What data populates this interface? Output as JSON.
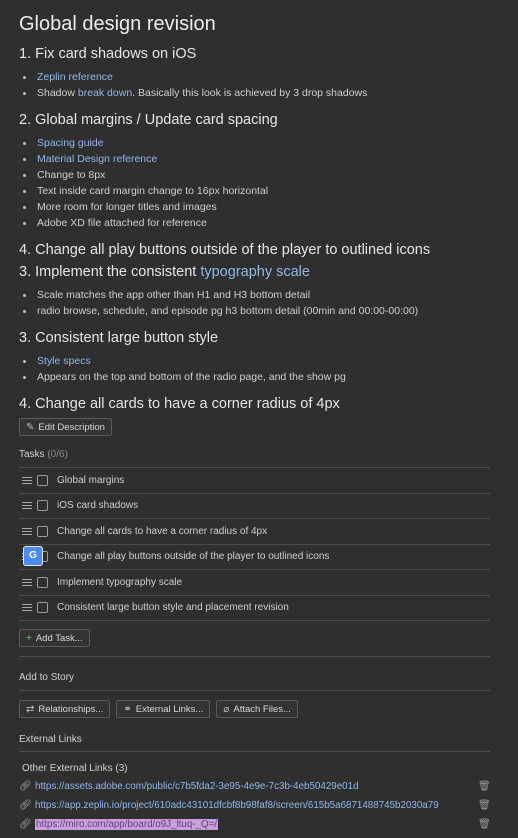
{
  "title": "Global design revision",
  "sections": {
    "s1": {
      "heading": "1. Fix card shadows on iOS",
      "items": [
        {
          "link": "Zeplin reference"
        }
      ],
      "shadow": {
        "pre": "Shadow ",
        "link": "break down",
        "post": ". Basically this look is achieved by 3 drop shadows"
      }
    },
    "s2": {
      "heading": "2. Global margins / Update card spacing",
      "links": [
        "Spacing guide",
        "Material Design reference"
      ],
      "items": [
        "Change to 8px",
        "Text inside card margin change to 16px horizontal",
        "More room for longer titles and images",
        "Adobe XD file attached for reference"
      ]
    },
    "s3": {
      "heading": "4. Change all play buttons outside of the player to outlined icons"
    },
    "s4": {
      "heading_pre": "3. Implement the consistent ",
      "heading_link": "typography scale",
      "items": [
        "Scale matches the app other than H1 and H3 bottom detail",
        "radio browse, schedule, and episode pg h3 bottom detail (00min and 00:00-00:00)"
      ]
    },
    "s5": {
      "heading": "3. Consistent large button style",
      "link": "Style specs",
      "items": [
        "Appears on the top and bottom of the radio page, and the show pg"
      ]
    },
    "s6": {
      "heading": "4. Change all cards to have a corner radius of 4px"
    }
  },
  "edit_description": "Edit Description",
  "tasks": {
    "label": "Tasks",
    "count": "(0/6)",
    "items": [
      "Global margins",
      "iOS card shadows",
      "Change all cards to have a corner radius of 4px",
      "Change all play buttons outside of the player to outlined icons",
      "Implement typography scale",
      "Consistent large button style and placement revision"
    ],
    "add_label": "Add Task..."
  },
  "story": {
    "label": "Add to Story",
    "buttons": [
      "Relationships...",
      "External Links...",
      "Attach Files..."
    ]
  },
  "external": {
    "label": "External Links",
    "sub": "Other External Links (3)",
    "links": [
      "https://assets.adobe.com/public/c7b5fda2-3e95-4e9e-7c3b-4eb50429e01d",
      "https://app.zeplin.io/project/610adc43101dfcbf8b98faf8/screen/615b5a6871488745b2030a79",
      "https://miro.com/app/board/o9J_ltuq-_Q=/"
    ]
  },
  "colors": {
    "background": "#2f2f2f",
    "link": "#8fb8ea",
    "highlight": "#c8a0d8"
  }
}
